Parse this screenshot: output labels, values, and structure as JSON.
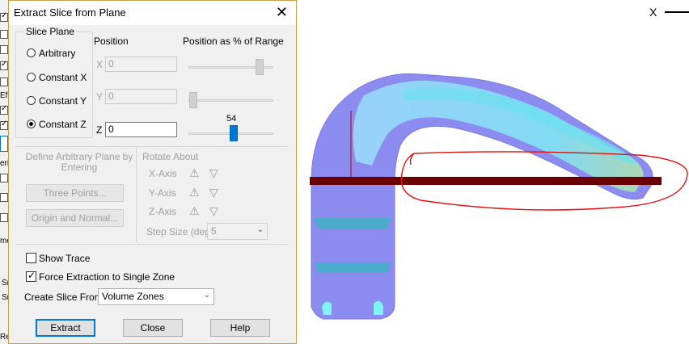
{
  "dialog": {
    "title": "Extract Slice from Plane",
    "slice_plane": {
      "group_label": "Slice Plane",
      "options": [
        "Arbitrary",
        "Constant X",
        "Constant Y",
        "Constant Z"
      ],
      "selected": "Constant Z"
    },
    "position": {
      "label": "Position",
      "percent_label": "Position as % of Range",
      "rows": [
        {
          "axis": "X",
          "value": "0",
          "enabled": false,
          "percent": 0.83
        },
        {
          "axis": "Y",
          "value": "0",
          "enabled": false,
          "percent": 0.0
        },
        {
          "axis": "Z",
          "value": "0",
          "enabled": true,
          "percent": 0.54
        }
      ],
      "z_percent_text": "54"
    },
    "arbitrary": {
      "define_label": "Define Arbitrary Plane by Entering",
      "three_points_label": "Three Points...",
      "origin_normal_label": "Origin and Normal...",
      "rotate_about_label": "Rotate About",
      "axes": [
        "X-Axis",
        "Y-Axis",
        "Z-Axis"
      ],
      "step_size_label": "Step Size (deg)",
      "step_size_value": "5"
    },
    "show_trace_label": "Show Trace",
    "show_trace_checked": false,
    "force_extraction_label": "Force Extraction to Single Zone",
    "force_extraction_checked": true,
    "create_from_label": "Create Slice From:",
    "create_from_value": "Volume Zones",
    "buttons": {
      "extract": "Extract",
      "close": "Close",
      "help": "Help"
    }
  },
  "background_app": {
    "axis_label": "X",
    "left_strip_text": [
      "Eff",
      "eriv",
      "me",
      "Sr",
      "Sr",
      "Re"
    ]
  },
  "colors": {
    "accent": "#0078d7",
    "slice_plane": "#6b0000",
    "annotation": "#e01010",
    "pipe_blue": "#8c8cf0",
    "pipe_cyan": "#7ef4f4"
  }
}
